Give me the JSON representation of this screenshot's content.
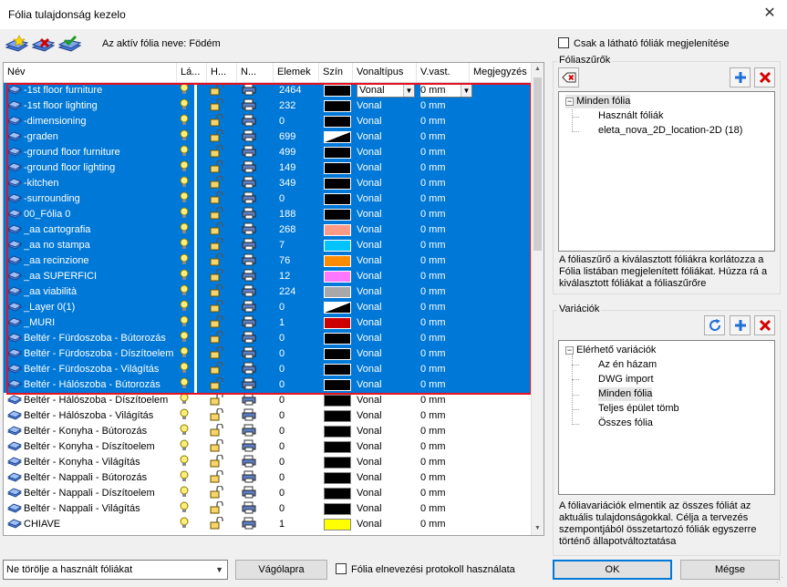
{
  "window": {
    "title": "Fólia tulajdonság kezelo",
    "close_glyph": "✕"
  },
  "toolbar": {
    "buttons": [
      {
        "icon": "new-layer-icon"
      },
      {
        "icon": "delete-layer-icon"
      },
      {
        "icon": "set-active-layer-icon"
      }
    ],
    "active_folia_label": "Az aktív fólia neve: Födém"
  },
  "table": {
    "headers": {
      "name": "Név",
      "visible": "Lá...",
      "lock": "H...",
      "print": "N...",
      "elements": "Elemek",
      "color": "Szín",
      "linetype": "Vonaltípus",
      "lineweight": "V.vast.",
      "comment": "Megjegyzés"
    },
    "rows": [
      {
        "name": "-1st floor furniture",
        "count": "2464",
        "color": "#000000",
        "linetype": "Vonal",
        "lineweight": "0 mm",
        "selected": true,
        "editing": true
      },
      {
        "name": "-1st floor lighting",
        "count": "232",
        "color": "#000000",
        "linetype": "Vonal",
        "lineweight": "0 mm",
        "selected": true
      },
      {
        "name": "-dimensioning",
        "count": "0",
        "color": "#000000",
        "linetype": "Vonal",
        "lineweight": "0 mm",
        "selected": true
      },
      {
        "name": "-graden",
        "count": "699",
        "color": "diag",
        "linetype": "Vonal",
        "lineweight": "0 mm",
        "selected": true
      },
      {
        "name": "-ground floor furniture",
        "count": "499",
        "color": "#000000",
        "linetype": "Vonal",
        "lineweight": "0 mm",
        "selected": true
      },
      {
        "name": "-ground floor lighting",
        "count": "149",
        "color": "#000000",
        "linetype": "Vonal",
        "lineweight": "0 mm",
        "selected": true
      },
      {
        "name": "-kitchen",
        "count": "349",
        "color": "#000000",
        "linetype": "Vonal",
        "lineweight": "0 mm",
        "selected": true
      },
      {
        "name": "-surrounding",
        "count": "0",
        "color": "#000000",
        "linetype": "Vonal",
        "lineweight": "0 mm",
        "selected": true
      },
      {
        "name": "00_Fólia 0",
        "count": "188",
        "color": "#000000",
        "linetype": "Vonal",
        "lineweight": "0 mm",
        "selected": true
      },
      {
        "name": "_aa cartografia",
        "count": "268",
        "color": "#ff9a86",
        "linetype": "Vonal",
        "lineweight": "0 mm",
        "selected": true
      },
      {
        "name": "_aa no stampa",
        "count": "7",
        "color": "#00c3ff",
        "linetype": "Vonal",
        "lineweight": "0 mm",
        "selected": true
      },
      {
        "name": "_aa recinzione",
        "count": "76",
        "color": "#ff8c00",
        "linetype": "Vonal",
        "lineweight": "0 mm",
        "selected": true
      },
      {
        "name": "_aa SUPERFICI",
        "count": "12",
        "color": "#ff78ff",
        "linetype": "Vonal",
        "lineweight": "0 mm",
        "selected": true
      },
      {
        "name": "_aa viabilità",
        "count": "224",
        "color": "#a8a8a8",
        "linetype": "Vonal",
        "lineweight": "0 mm",
        "selected": true
      },
      {
        "name": "_Layer 0(1)",
        "count": "0",
        "color": "diag",
        "linetype": "Vonal",
        "lineweight": "0 mm",
        "selected": true
      },
      {
        "name": "_MURI",
        "count": "1",
        "color": "#cc0000",
        "linetype": "Vonal",
        "lineweight": "0 mm",
        "selected": true
      },
      {
        "name": "Beltér - Fürdoszoba - Bútorozás",
        "count": "0",
        "color": "#000000",
        "linetype": "Vonal",
        "lineweight": "0 mm",
        "selected": true
      },
      {
        "name": "Beltér - Fürdoszoba - Díszítoelem",
        "count": "0",
        "color": "#000000",
        "linetype": "Vonal",
        "lineweight": "0 mm",
        "selected": true
      },
      {
        "name": "Beltér - Fürdoszoba - Világítás",
        "count": "0",
        "color": "#000000",
        "linetype": "Vonal",
        "lineweight": "0 mm",
        "selected": true
      },
      {
        "name": "Beltér - Hálószoba - Bútorozás",
        "count": "0",
        "color": "#000000",
        "linetype": "Vonal",
        "lineweight": "0 mm",
        "selected": true
      },
      {
        "name": "Beltér - Hálószoba - Díszítoelem",
        "count": "0",
        "color": "#000000",
        "linetype": "Vonal",
        "lineweight": "0 mm",
        "selected": false
      },
      {
        "name": "Beltér - Hálószoba - Világítás",
        "count": "0",
        "color": "#000000",
        "linetype": "Vonal",
        "lineweight": "0 mm",
        "selected": false
      },
      {
        "name": "Beltér - Konyha - Bútorozás",
        "count": "0",
        "color": "#000000",
        "linetype": "Vonal",
        "lineweight": "0 mm",
        "selected": false
      },
      {
        "name": "Beltér - Konyha - Díszítoelem",
        "count": "0",
        "color": "#000000",
        "linetype": "Vonal",
        "lineweight": "0 mm",
        "selected": false
      },
      {
        "name": "Beltér - Konyha - Világítás",
        "count": "0",
        "color": "#000000",
        "linetype": "Vonal",
        "lineweight": "0 mm",
        "selected": false
      },
      {
        "name": "Beltér - Nappali - Bútorozás",
        "count": "0",
        "color": "#000000",
        "linetype": "Vonal",
        "lineweight": "0 mm",
        "selected": false
      },
      {
        "name": "Beltér - Nappali - Díszítoelem",
        "count": "0",
        "color": "#000000",
        "linetype": "Vonal",
        "lineweight": "0 mm",
        "selected": false
      },
      {
        "name": "Beltér - Nappali - Világítás",
        "count": "0",
        "color": "#000000",
        "linetype": "Vonal",
        "lineweight": "0 mm",
        "selected": false
      },
      {
        "name": "CHIAVE",
        "count": "1",
        "color": "#ffff00",
        "linetype": "Vonal",
        "lineweight": "0 mm",
        "selected": false
      }
    ]
  },
  "right": {
    "show_visible_label": "Csak a látható fóliák megjelenítése",
    "filters": {
      "label": "Fóliaszűrők",
      "root": "Minden fólia",
      "children": [
        "Használt fóliák",
        "eleta_nova_2D_location-2D (18)"
      ],
      "description": "A fóliaszűrő a kiválasztott fóliákra korlátozza a Fólia listában megjelenített fóliákat. Húzza rá a kiválasztott fóliákat a fóliaszűrőre"
    },
    "variations": {
      "label": "Variációk",
      "root": "Elérhető variációk",
      "children": [
        "Az én házam",
        "DWG import",
        "Minden fólia",
        "Teljes épület tömb",
        "Összes fólia"
      ],
      "highlighted": "Minden fólia",
      "description": "A fóliavariációk elmentik az összes fóliát az aktuális tulajdonságokkal. Célja a tervezés szempontjából összetartozó fóliák egyszerre történő állapotváltoztatása"
    }
  },
  "bottom": {
    "delete_mode": "Ne törölje a használt fóliákat",
    "clipboard": "Vágólapra",
    "protocol_label": "Fólia elnevezési protokoll használata",
    "ok": "OK",
    "cancel": "Mégse"
  }
}
